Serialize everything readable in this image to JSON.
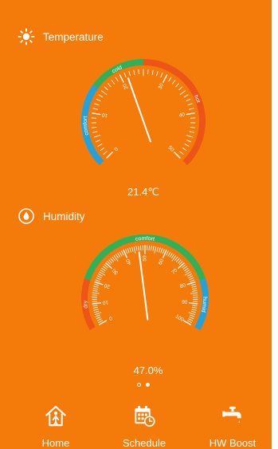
{
  "colors": {
    "background": "#f47b0a",
    "comfort_blue": "#1ea3e0",
    "comfort_green": "#2fb15a",
    "hot_red": "#ec5418",
    "white": "#ffffff"
  },
  "temperature": {
    "header": "Temperature",
    "icon": "sun-icon",
    "value_text": "21.4℃",
    "value": 21.4,
    "scale_min": 0,
    "scale_max": 50,
    "major_labels": [
      "0",
      "10",
      "20",
      "30",
      "40",
      "50"
    ],
    "zones": [
      {
        "label": "comfort",
        "color": "#1ea3e0",
        "from": 0,
        "to": 15
      },
      {
        "label": "cold",
        "color": "#2fb15a",
        "from": 15,
        "to": 25
      },
      {
        "label": "hot",
        "color": "#ec5418",
        "from": 25,
        "to": 50
      }
    ]
  },
  "humidity": {
    "header": "Humidity",
    "icon": "droplet-icon",
    "value_text": "47.0%",
    "value": 47.0,
    "scale_min": 0,
    "scale_max": 100,
    "major_labels": [
      "0",
      "10",
      "20",
      "30",
      "40",
      "50",
      "60",
      "70",
      "80",
      "90",
      "100"
    ],
    "zones": [
      {
        "label": "dry",
        "color": "#ec5418",
        "from": 0,
        "to": 20
      },
      {
        "label": "comfort",
        "color": "#2fb15a",
        "from": 20,
        "to": 80
      },
      {
        "label": "humid",
        "color": "#1ea3e0",
        "from": 80,
        "to": 100
      }
    ]
  },
  "pager": {
    "pages": 2,
    "current": 2
  },
  "nav": {
    "items": [
      {
        "label": "Home",
        "icon": "home-icon"
      },
      {
        "label": "Schedule",
        "icon": "calendar-clock-icon"
      },
      {
        "label": "HW Boost",
        "icon": "faucet-icon"
      }
    ]
  }
}
